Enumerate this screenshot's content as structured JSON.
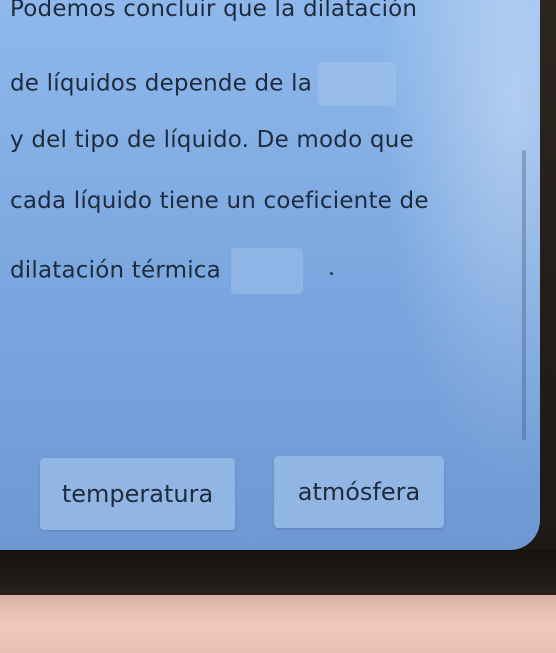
{
  "question": {
    "line1": "Podemos concluir que la dilatación",
    "line2": "de líquidos depende de la",
    "line3": "y del tipo de líquido. De modo que",
    "line4": "cada líquido tiene un coeficiente de",
    "line5": "dilatación térmica"
  },
  "options": [
    {
      "label": "temperatura"
    },
    {
      "label": "atmósfera"
    }
  ]
}
